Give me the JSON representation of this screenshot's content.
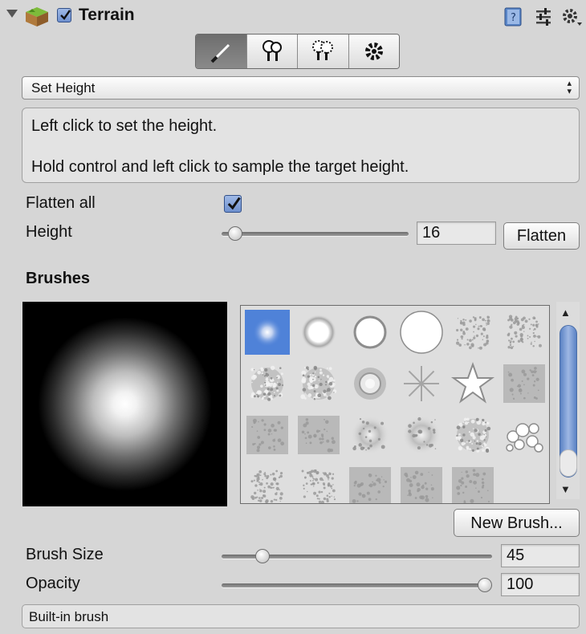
{
  "header": {
    "title": "Terrain",
    "enabled": true,
    "icons": [
      "foldout-arrow-icon",
      "terrain-icon",
      "help-book-icon",
      "preset-sliders-icon",
      "settings-gear-icon"
    ]
  },
  "toolbar": {
    "tools": [
      {
        "name": "paint-brush-icon",
        "active": true
      },
      {
        "name": "place-trees-icon",
        "active": false
      },
      {
        "name": "paint-details-icon",
        "active": false
      },
      {
        "name": "settings-icon",
        "active": false
      }
    ]
  },
  "tool_select": {
    "value": "Set Height"
  },
  "help": {
    "line1": "Left click to set the height.",
    "line2": "Hold control and left click to sample the target height."
  },
  "flatten_all": {
    "label": "Flatten all",
    "checked": true
  },
  "height": {
    "label": "Height",
    "value": "16",
    "slider_fraction": 0.02,
    "button": "Flatten"
  },
  "brushes": {
    "heading": "Brushes",
    "new_brush_button": "New Brush...",
    "items": [
      "soft-round",
      "blur-round",
      "hard-round-small",
      "hard-round",
      "speckle",
      "speckle-dense",
      "noise-blob",
      "splatter",
      "rose",
      "starburst",
      "star",
      "smudge",
      "scratch",
      "streaks",
      "cloud",
      "cloud-soft",
      "leaves",
      "bubbles",
      "gravel",
      "pebbles",
      "mesh",
      "soft-square",
      "grunge"
    ],
    "selected_index": 0
  },
  "brush_size": {
    "label": "Brush Size",
    "value": "45",
    "slider_fraction": 0.12
  },
  "opacity": {
    "label": "Opacity",
    "value": "100",
    "slider_fraction": 1.0
  },
  "footer": {
    "text": "Built-in brush"
  },
  "colors": {
    "accent": "#4f82d8",
    "panel": "#d6d6d6",
    "scroll_thumb": "#7d9ed6"
  }
}
